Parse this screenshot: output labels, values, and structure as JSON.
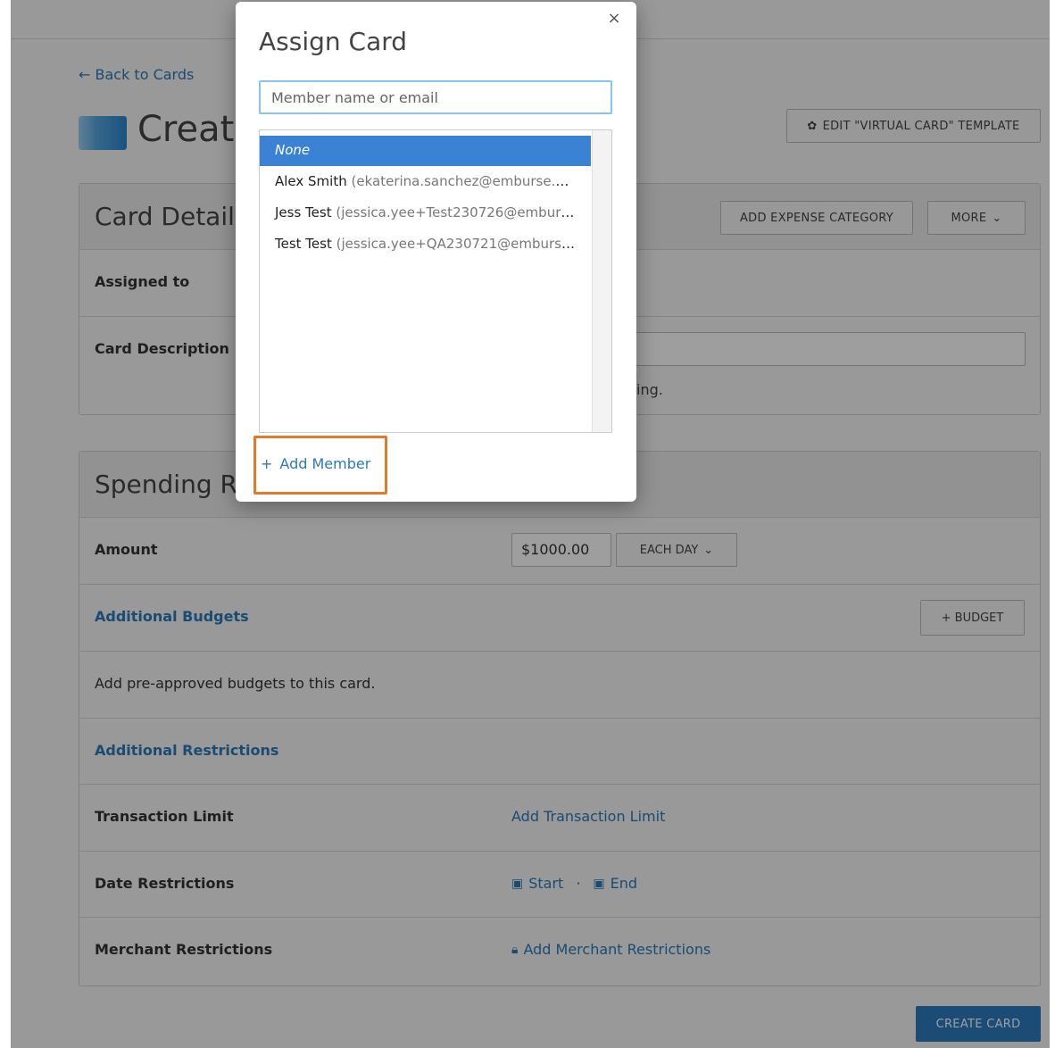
{
  "header": {
    "back_link": "← Back to Cards",
    "page_title": "Create",
    "template_button": "EDIT \"VIRTUAL CARD\" TEMPLATE",
    "template_icon": "gear-icon"
  },
  "card_details": {
    "title": "Card Details",
    "add_expense_category": "ADD EXPENSE CATEGORY",
    "more_button": "MORE",
    "rows": {
      "assigned_to": "Assigned to",
      "card_description": "Card Description",
      "description_help_partial": "ing."
    }
  },
  "spending": {
    "title": "Spending Re",
    "amount_label": "Amount",
    "amount_value": "$1000.00",
    "period_label": "EACH DAY",
    "additional_budgets": "Additional Budgets",
    "budget_button": "+ BUDGET",
    "budgets_help": "Add pre-approved budgets to this card.",
    "additional_restrictions": "Additional Restrictions",
    "transaction_limit_label": "Transaction Limit",
    "transaction_limit_action": "Add Transaction Limit",
    "date_restrictions_label": "Date Restrictions",
    "date_start": "Start",
    "date_separator": "·",
    "date_end": "End",
    "merchant_label": "Merchant Restrictions",
    "merchant_action": "Add Merchant Restrictions"
  },
  "create_button": "CREATE CARD",
  "modal": {
    "title": "Assign Card",
    "close": "×",
    "search_placeholder": "Member name or email",
    "options": [
      {
        "name": "None",
        "email": ""
      },
      {
        "name": "Alex Smith",
        "email": "(ekaterina.sanchez@emburse.co..."
      },
      {
        "name": "Jess Test",
        "email": "(jessica.yee+Test230726@emburse..."
      },
      {
        "name": "Test Test",
        "email": "(jessica.yee+QA230721@emburse...."
      }
    ],
    "add_member": "Add Member",
    "add_member_icon": "+"
  },
  "colors": {
    "accent": "#2a7ab8",
    "selected": "#3b82d4",
    "highlight": "#e07b2a",
    "create_button": "#2b7bbf"
  }
}
